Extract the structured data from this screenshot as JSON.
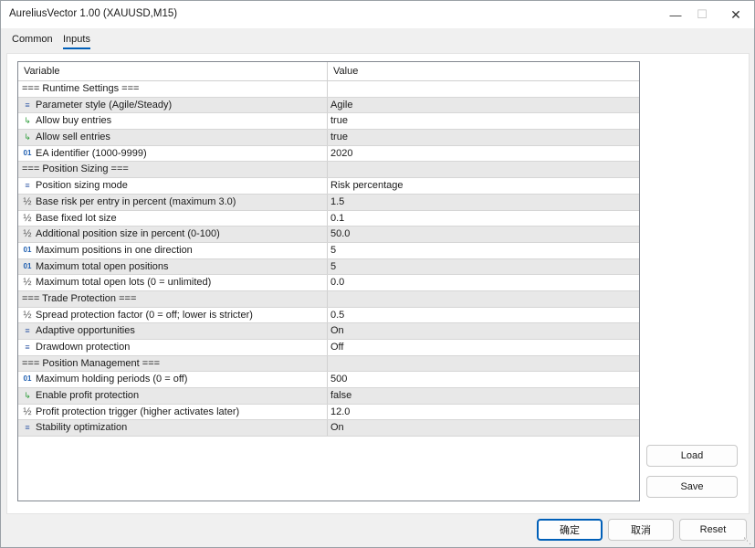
{
  "window": {
    "title": "AureliusVector 1.00 (XAUUSD,M15)",
    "minimize_icon": "minimize-icon",
    "maximize_icon": "maximize-icon",
    "close_icon": "close-icon"
  },
  "tabs": [
    {
      "label": "Common",
      "active": false
    },
    {
      "label": "Inputs",
      "active": true
    }
  ],
  "grid": {
    "columns": {
      "variable": "Variable",
      "value": "Value"
    },
    "rows": [
      {
        "type": "header",
        "name": "=== Runtime Settings ===",
        "value": ""
      },
      {
        "type": "list",
        "icon": "list-icon",
        "name": "Parameter style (Agile/Steady)",
        "value": "Agile"
      },
      {
        "type": "bool",
        "icon": "bool-arrow-icon",
        "name": "Allow buy entries",
        "value": "true"
      },
      {
        "type": "bool",
        "icon": "bool-arrow-icon",
        "name": "Allow sell entries",
        "value": "true"
      },
      {
        "type": "int",
        "icon": "int-icon",
        "name": "EA identifier (1000-9999)",
        "value": "2020"
      },
      {
        "type": "header",
        "name": "=== Position Sizing ===",
        "value": ""
      },
      {
        "type": "list",
        "icon": "list-icon",
        "name": "Position sizing mode",
        "value": "Risk percentage"
      },
      {
        "type": "double",
        "icon": "double-icon",
        "name": "Base risk per entry in percent (maximum 3.0)",
        "value": "1.5"
      },
      {
        "type": "double",
        "icon": "double-icon",
        "name": "Base fixed lot size",
        "value": "0.1"
      },
      {
        "type": "double",
        "icon": "double-icon",
        "name": "Additional position size in percent (0-100)",
        "value": "50.0"
      },
      {
        "type": "int",
        "icon": "int-icon",
        "name": "Maximum positions in one direction",
        "value": "5"
      },
      {
        "type": "int",
        "icon": "int-icon",
        "name": "Maximum total open positions",
        "value": "5"
      },
      {
        "type": "double",
        "icon": "double-icon",
        "name": "Maximum total open lots (0 = unlimited)",
        "value": "0.0"
      },
      {
        "type": "header",
        "name": "=== Trade Protection ===",
        "value": ""
      },
      {
        "type": "double",
        "icon": "double-icon",
        "name": "Spread protection factor (0 = off; lower is stricter)",
        "value": "0.5"
      },
      {
        "type": "list",
        "icon": "list-icon",
        "name": "Adaptive opportunities",
        "value": "On"
      },
      {
        "type": "list",
        "icon": "list-icon",
        "name": "Drawdown protection",
        "value": "Off"
      },
      {
        "type": "header",
        "name": "=== Position Management ===",
        "value": ""
      },
      {
        "type": "int",
        "icon": "int-icon",
        "name": "Maximum holding periods (0 = off)",
        "value": "500"
      },
      {
        "type": "bool",
        "icon": "bool-arrow-icon",
        "name": "Enable profit protection",
        "value": "false"
      },
      {
        "type": "double",
        "icon": "double-icon",
        "name": "Profit protection trigger (higher activates later)",
        "value": "12.0"
      },
      {
        "type": "list",
        "icon": "list-icon",
        "name": "Stability optimization",
        "value": "On"
      }
    ]
  },
  "buttons": {
    "load": "Load",
    "save": "Save",
    "ok": "确定",
    "cancel": "取消",
    "reset": "Reset"
  }
}
